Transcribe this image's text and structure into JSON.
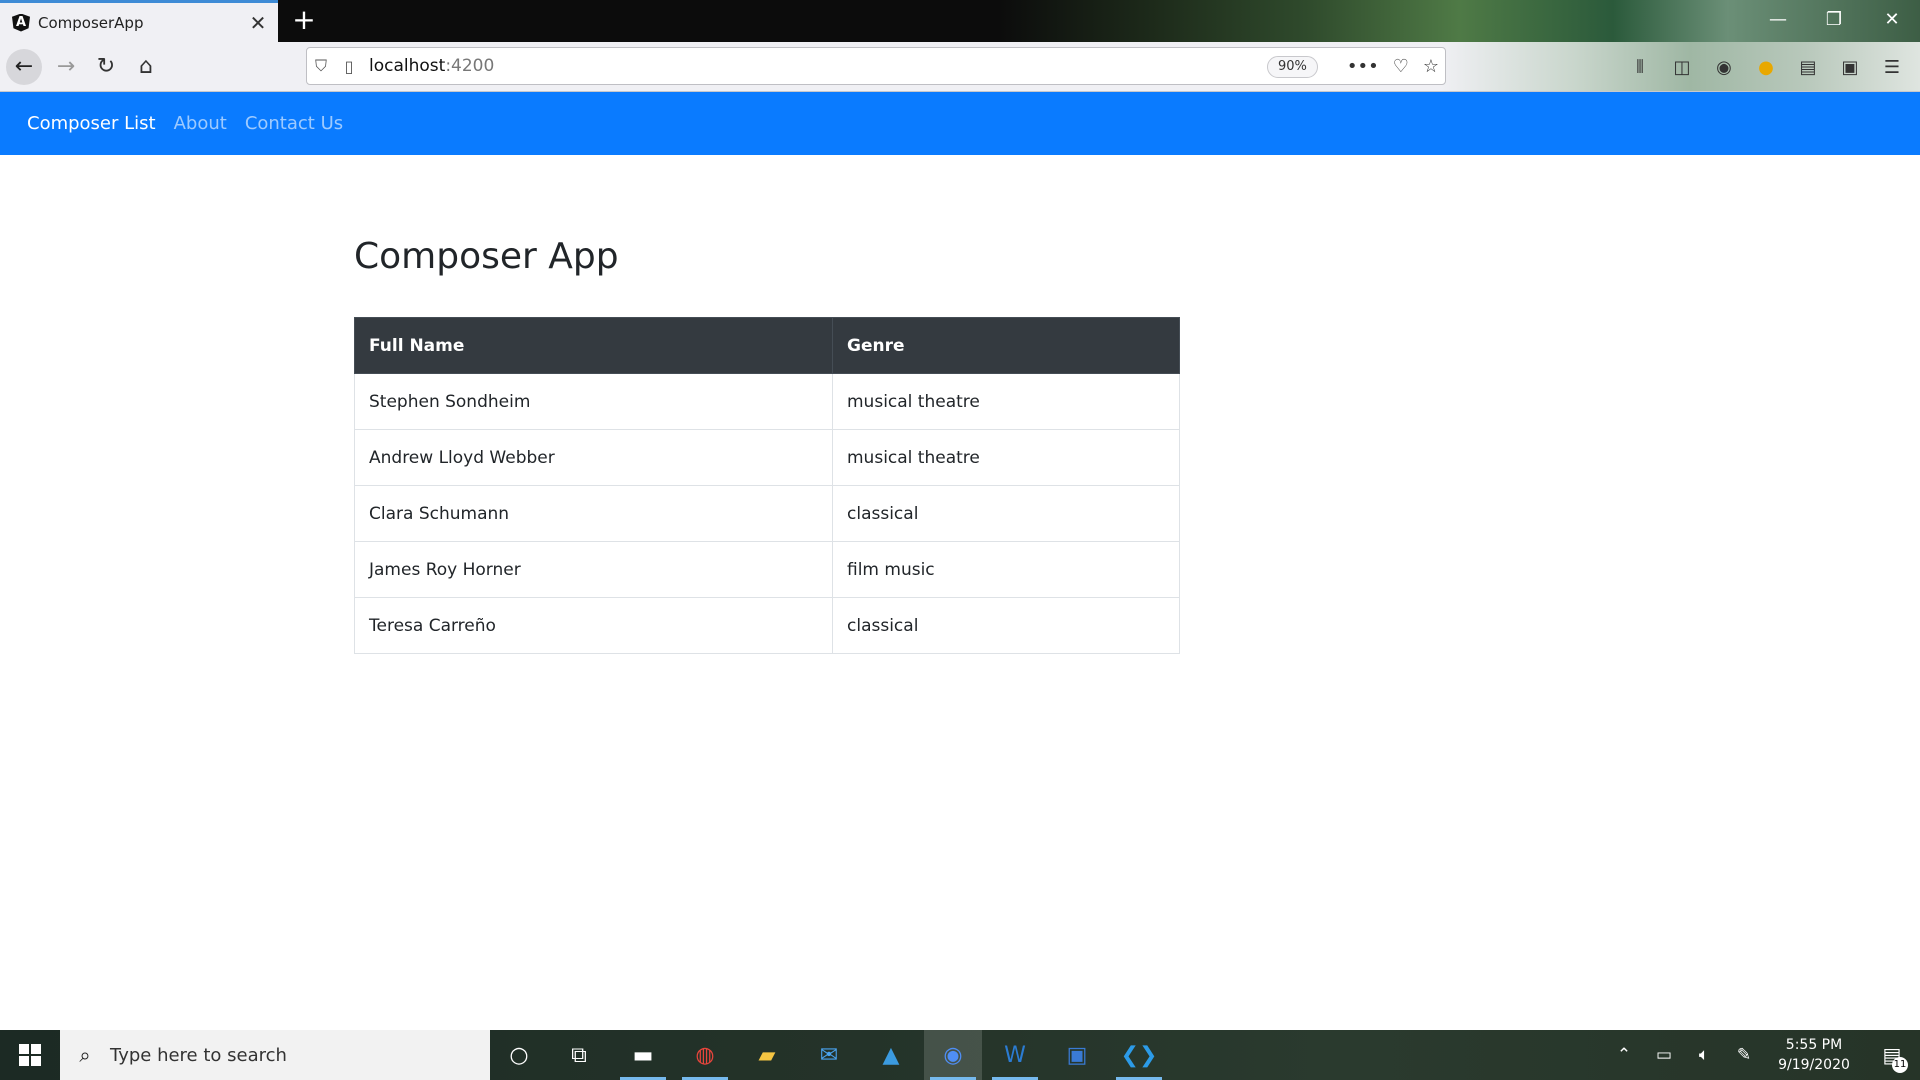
{
  "browser": {
    "tab_title": "ComposerApp",
    "tab_close": "✕",
    "new_tab": "+",
    "url_host": "localhost",
    "url_port": ":4200",
    "zoom": "90%",
    "window_controls": {
      "minimize": "—",
      "restore": "❐",
      "close": "✕"
    }
  },
  "app_nav": {
    "items": [
      {
        "label": "Composer List",
        "active": true
      },
      {
        "label": "About",
        "active": false
      },
      {
        "label": "Contact Us",
        "active": false
      }
    ]
  },
  "page": {
    "title": "Composer App",
    "table": {
      "headers": [
        "Full Name",
        "Genre"
      ],
      "rows": [
        [
          "Stephen Sondheim",
          "musical theatre"
        ],
        [
          "Andrew Lloyd Webber",
          "musical theatre"
        ],
        [
          "Clara Schumann",
          "classical"
        ],
        [
          "James Roy Horner",
          "film music"
        ],
        [
          "Teresa Carreño",
          "classical"
        ]
      ]
    }
  },
  "taskbar": {
    "search_placeholder": "Type here to search",
    "time": "5:55 PM",
    "date": "9/19/2020",
    "notification_count": "11"
  },
  "colors": {
    "app_nav_bg": "#0a7bff",
    "table_header_bg": "#343a40"
  }
}
